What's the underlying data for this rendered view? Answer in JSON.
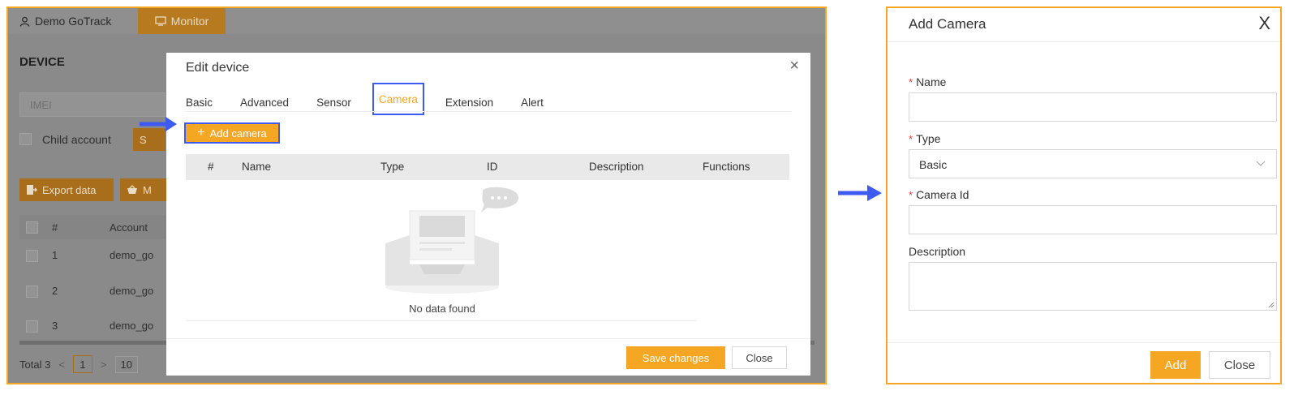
{
  "background": {
    "user_label": "Demo GoTrack",
    "monitor_label": "Monitor",
    "page_title": "DEVICE",
    "imei_placeholder": "IMEI",
    "child_account_label": "Child account",
    "search_btn_partial": "S",
    "export_label": "Export data",
    "more_btn_partial": "M",
    "table": {
      "hash": "#",
      "account_header": "Account",
      "rows": [
        {
          "num": "1",
          "account": "demo_go"
        },
        {
          "num": "2",
          "account": "demo_go"
        },
        {
          "num": "3",
          "account": "demo_go"
        }
      ]
    },
    "footer": {
      "total": "Total 3",
      "page": "1",
      "page_size_partial": "10"
    }
  },
  "edit_modal": {
    "title": "Edit device",
    "close_glyph": "×",
    "tabs": [
      {
        "label": "Basic"
      },
      {
        "label": "Advanced"
      },
      {
        "label": "Sensor"
      },
      {
        "label": "Camera"
      },
      {
        "label": "Extension"
      },
      {
        "label": "Alert"
      }
    ],
    "active_tab": "Camera",
    "add_camera_label": "Add camera",
    "columns": [
      "#",
      "Name",
      "Type",
      "ID",
      "Description",
      "Functions"
    ],
    "empty_text": "No data found",
    "save_label": "Save changes",
    "close_label": "Close"
  },
  "add_camera": {
    "title": "Add Camera",
    "close_glyph": "X",
    "required_mark": "*",
    "fields": {
      "name": {
        "label": "Name",
        "value": ""
      },
      "type": {
        "label": "Type",
        "value": "Basic"
      },
      "camera_id": {
        "label": "Camera Id",
        "value": ""
      },
      "description": {
        "label": "Description",
        "value": ""
      }
    },
    "add_label": "Add",
    "close_label": "Close"
  },
  "colors": {
    "accent": "#f5a623",
    "highlight": "#3d5af1",
    "required": "#e53935"
  },
  "icons": [
    "user-icon",
    "monitor-icon",
    "close-icon",
    "plus-icon",
    "export-icon",
    "basket-icon",
    "empty-inbox-icon",
    "chevron-down-icon",
    "arrow-right-icon"
  ]
}
